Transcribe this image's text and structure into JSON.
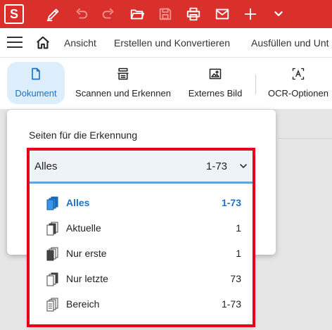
{
  "colors": {
    "titlebar": "#d9302c",
    "accent": "#1a73c8",
    "highlight": "#e8001a",
    "ribbon_active_bg": "#dceefb"
  },
  "titlebar": {
    "logo_letter": "S",
    "icons": [
      "pen-icon",
      "undo-icon",
      "redo-icon",
      "open-folder-icon",
      "save-icon",
      "print-icon",
      "mail-icon",
      "plus-icon",
      "chevron-down-icon"
    ]
  },
  "menubar": {
    "items": [
      "Ansicht",
      "Erstellen und Konvertieren",
      "Ausfüllen und Unt"
    ]
  },
  "ribbon": {
    "buttons": [
      {
        "label": "Dokument",
        "icon": "document-icon",
        "active": true
      },
      {
        "label": "Scannen und Erkennen",
        "icon": "scanner-icon",
        "active": false
      },
      {
        "label": "Externes Bild",
        "icon": "image-icon",
        "active": false
      },
      {
        "label": "OCR-Optionen",
        "icon": "ocr-icon",
        "active": false
      }
    ]
  },
  "panel": {
    "title": "Seiten für die Erkennung",
    "select": {
      "value": "Alles",
      "range": "1-73"
    },
    "options": [
      {
        "label": "Alles",
        "count": "1-73",
        "selected": true,
        "icon": "all-pages-icon"
      },
      {
        "label": "Aktuelle",
        "count": "1",
        "selected": false,
        "icon": "current-page-icon"
      },
      {
        "label": "Nur erste",
        "count": "1",
        "selected": false,
        "icon": "first-page-icon"
      },
      {
        "label": "Nur letzte",
        "count": "73",
        "selected": false,
        "icon": "last-page-icon"
      },
      {
        "label": "Bereich",
        "count": "1-73",
        "selected": false,
        "icon": "range-pages-icon"
      }
    ]
  }
}
